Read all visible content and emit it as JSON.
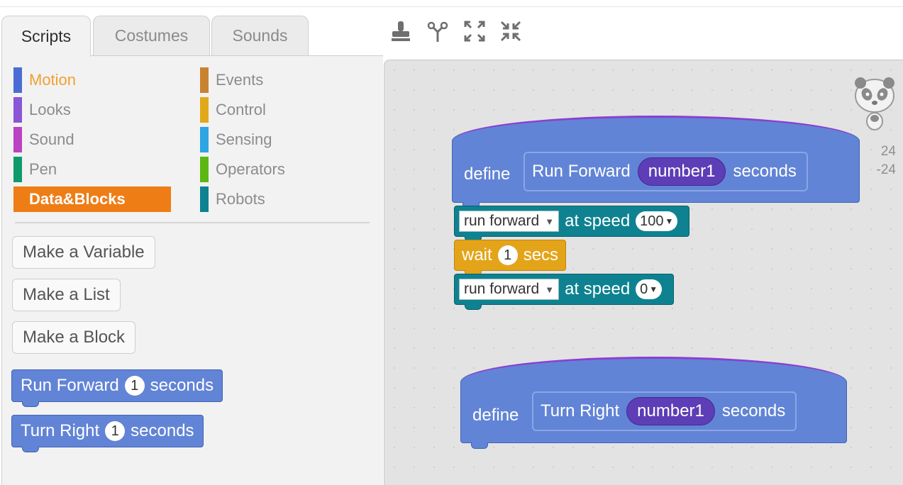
{
  "tabs": [
    {
      "label": "Scripts",
      "active": true
    },
    {
      "label": "Costumes",
      "active": false
    },
    {
      "label": "Sounds",
      "active": false
    }
  ],
  "toolbar": {
    "icons": [
      "duplicate-stamp-icon",
      "delete-scissors-icon",
      "grow-icon",
      "shrink-icon"
    ]
  },
  "categories": {
    "left": [
      {
        "label": "Motion",
        "color": "#4a6cd4"
      },
      {
        "label": "Looks",
        "color": "#8a55d7"
      },
      {
        "label": "Sound",
        "color": "#bb42c3"
      },
      {
        "label": "Pen",
        "color": "#0e9a6c"
      },
      {
        "label": "Data&Blocks",
        "color": "#ee7d16",
        "selected": true
      }
    ],
    "right": [
      {
        "label": "Events",
        "color": "#c88330"
      },
      {
        "label": "Control",
        "color": "#e1a91a"
      },
      {
        "label": "Sensing",
        "color": "#2ca5e2"
      },
      {
        "label": "Operators",
        "color": "#5cb712"
      },
      {
        "label": "Robots",
        "color": "#0e8290"
      }
    ]
  },
  "palette_buttons": {
    "make_variable": "Make a Variable",
    "make_list": "Make a List",
    "make_block": "Make a Block"
  },
  "palette_blocks": [
    {
      "pre": "Run Forward",
      "value": "1",
      "post": "seconds"
    },
    {
      "pre": "Turn Right",
      "value": "1",
      "post": "seconds"
    }
  ],
  "scripts": {
    "define_label": "define",
    "script1": {
      "name": "Run Forward",
      "param": "number1",
      "suffix": "seconds",
      "blocks": [
        {
          "dropdown": "run forward",
          "mid": "at speed",
          "value": "100"
        },
        {
          "pre": "wait",
          "value": "1",
          "post": "secs"
        },
        {
          "dropdown": "run forward",
          "mid": "at speed",
          "value": "0"
        }
      ]
    },
    "script2": {
      "name": "Turn Right",
      "param": "number1",
      "suffix": "seconds"
    }
  },
  "stage": {
    "sprite": "panda-sprite-icon",
    "x": "24",
    "y": "-24"
  }
}
